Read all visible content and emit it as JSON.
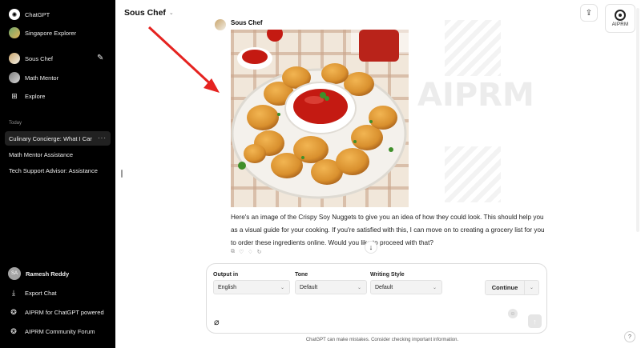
{
  "sidebar": {
    "top_items": [
      {
        "label": "ChatGPT",
        "icon": "openai-icon"
      },
      {
        "label": "Singapore Explorer",
        "icon": "gpt-avatar-icon"
      },
      {
        "label": "Sous Chef",
        "icon": "gpt-avatar-icon"
      },
      {
        "label": "Math Mentor",
        "icon": "gpt-avatar-icon"
      },
      {
        "label": "Explore",
        "icon": "grid-icon"
      }
    ],
    "section_label": "Today",
    "history": [
      {
        "label": "Culinary Concierge: What I Can",
        "active": true
      },
      {
        "label": "Math Mentor Assistance",
        "active": false
      },
      {
        "label": "Tech Support Advisor: Assistance",
        "active": false
      }
    ],
    "history_more": "···",
    "user": {
      "initials": "SA",
      "name": "Ramesh Reddy"
    },
    "bottom_items": [
      {
        "label": "Export Chat",
        "icon": "export-icon"
      },
      {
        "label": "AIPRM for ChatGPT powered",
        "icon": "aiprm-icon"
      },
      {
        "label": "AIPRM Community Forum",
        "icon": "forum-icon"
      }
    ]
  },
  "header": {
    "model_name": "Sous Chef",
    "share_icon": "share-icon",
    "brand_label": "AIPRM"
  },
  "watermark": {
    "text": "AIPRM"
  },
  "conversation": {
    "bot_name": "Sous Chef",
    "image_alt_subject": "Crispy Soy Nuggets with ketchup",
    "reply_text": "Here's an image of the Crispy Soy Nuggets to give you an idea of how they could look. This should help you as a visual guide for your cooking. If you're satisfied with this, I can move on to creating a grocery list for you to order these ingredients online. Would you like to proceed with that?"
  },
  "composer": {
    "output_label": "Output in",
    "output_value": "English",
    "tone_label": "Tone",
    "tone_value": "Default",
    "style_label": "Writing Style",
    "style_value": "Default",
    "continue_label": "Continue"
  },
  "footer": {
    "disclaimer": "ChatGPT can make mistakes. Consider checking important information.",
    "help": "?"
  },
  "colors": {
    "sidebar_bg": "#000000",
    "active_item_bg": "#212121",
    "arrow": "#e52320",
    "ketchup": "#c41a12",
    "nugget": "#d9902e"
  }
}
